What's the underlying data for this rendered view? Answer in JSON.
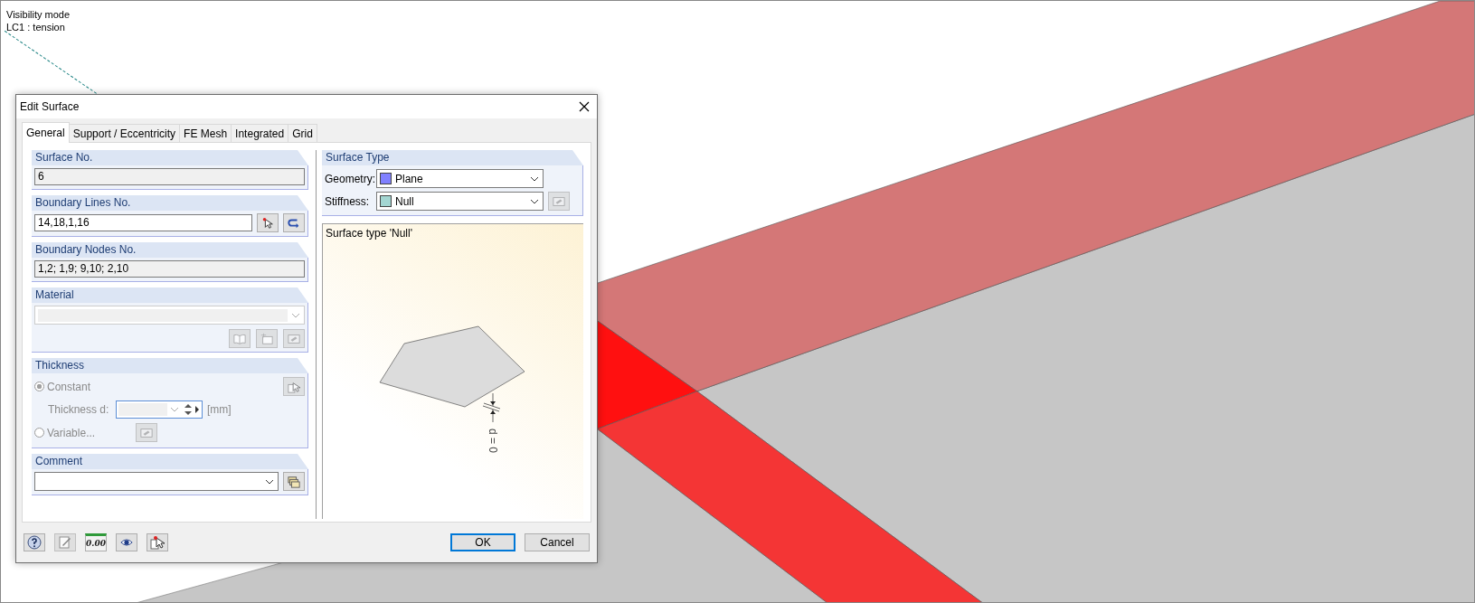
{
  "viewport": {
    "labels": [
      "Visibility mode",
      "LC1 : tension"
    ]
  },
  "dialog": {
    "title": "Edit Surface"
  },
  "tabs": [
    {
      "label": "General",
      "selected": true
    },
    {
      "label": "Support / Eccentricity",
      "selected": false
    },
    {
      "label": "FE Mesh",
      "selected": false
    },
    {
      "label": "Integrated",
      "selected": false
    },
    {
      "label": "Grid",
      "selected": false
    }
  ],
  "surface_no": {
    "title": "Surface No.",
    "value": "6"
  },
  "boundary_lines": {
    "title": "Boundary Lines No.",
    "value": "14,18,1,16"
  },
  "boundary_nodes": {
    "title": "Boundary Nodes No.",
    "value": "1,2; 1,9; 9,10; 2,10"
  },
  "material": {
    "title": "Material",
    "disabled": true
  },
  "thickness": {
    "title": "Thickness",
    "thickness_label": "Thickness d:",
    "unit": "[mm]",
    "options": [
      {
        "label": "Constant",
        "selected": true,
        "disabled": true
      },
      {
        "label": "Variable...",
        "selected": false,
        "disabled": true
      }
    ]
  },
  "comment": {
    "title": "Comment"
  },
  "surface_type": {
    "title": "Surface Type",
    "fields": [
      {
        "label": "Geometry:",
        "value": "Plane",
        "color": "#8080ff",
        "edit_button": false
      },
      {
        "label": "Stiffness:",
        "value": "Null",
        "color": "#a3d6d2",
        "edit_button": true
      }
    ]
  },
  "preview": {
    "caption": "Surface type 'Null'",
    "dimension": "d = 0"
  },
  "toolbar": {
    "decimals": "0.00"
  },
  "buttons": [
    {
      "label": "OK",
      "default": true
    },
    {
      "label": "Cancel",
      "default": false
    }
  ]
}
